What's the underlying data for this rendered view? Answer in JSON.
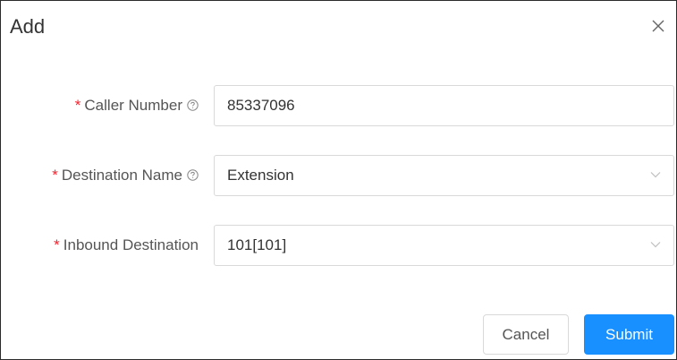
{
  "dialog": {
    "title": "Add",
    "close_icon": "close-icon"
  },
  "form": {
    "caller_number": {
      "required_mark": "*",
      "label": "Caller Number",
      "help_icon": "question-circle-icon",
      "value": "85337096"
    },
    "destination_name": {
      "required_mark": "*",
      "label": "Destination Name",
      "help_icon": "question-circle-icon",
      "value": "Extension"
    },
    "inbound_destination": {
      "required_mark": "*",
      "label": "Inbound Destination",
      "value": "101[101]"
    }
  },
  "buttons": {
    "cancel": "Cancel",
    "submit": "Submit"
  },
  "colors": {
    "primary": "#1890ff",
    "required": "#f5222d",
    "border": "#d9d9d9",
    "text": "#333333"
  }
}
